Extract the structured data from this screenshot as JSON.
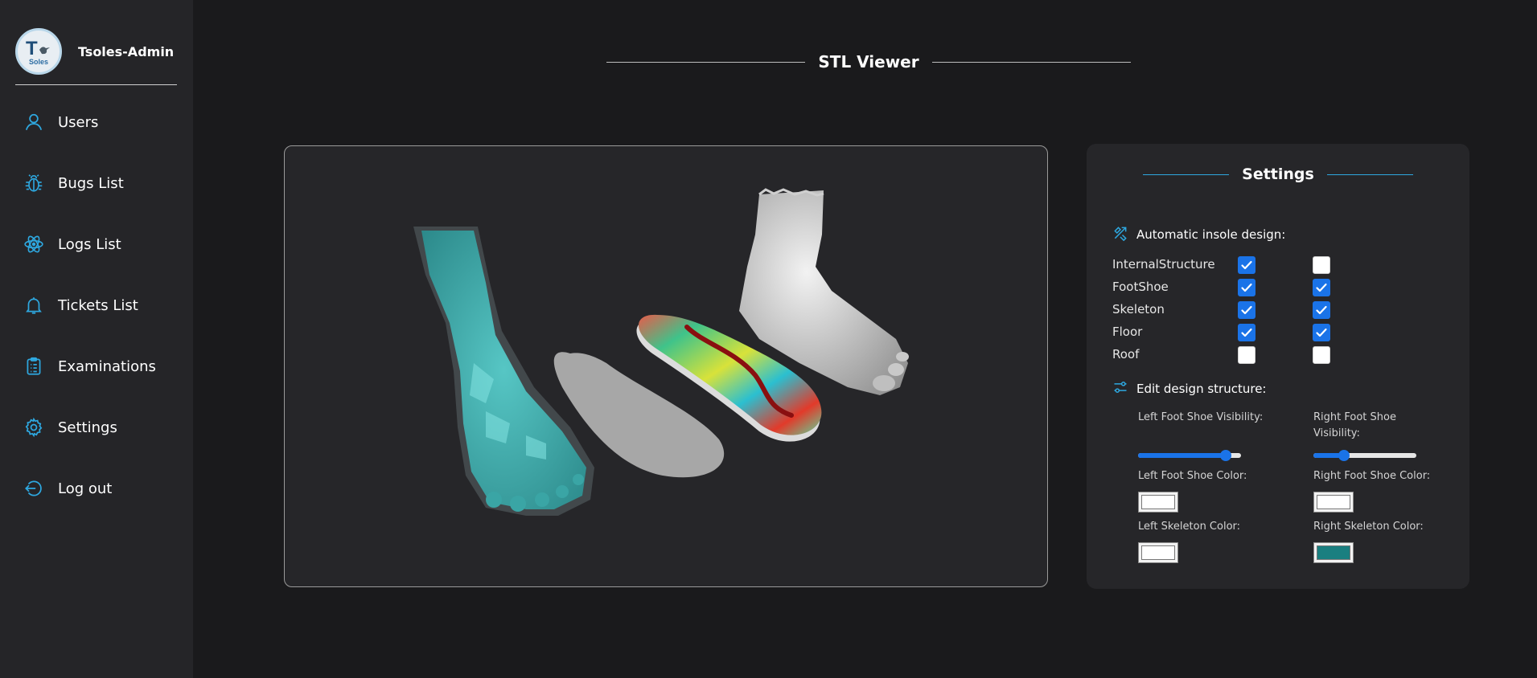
{
  "app": {
    "name": "Tsoles-Admin",
    "logo_text": "T",
    "logo_subtext": "Soles"
  },
  "sidebar": {
    "items": [
      {
        "label": "Users",
        "icon": "user-icon"
      },
      {
        "label": "Bugs List",
        "icon": "bug-icon"
      },
      {
        "label": "Logs List",
        "icon": "atom-icon"
      },
      {
        "label": "Tickets List",
        "icon": "bell-icon"
      },
      {
        "label": "Examinations",
        "icon": "clipboard-icon"
      },
      {
        "label": "Settings",
        "icon": "gear-icon"
      },
      {
        "label": "Log out",
        "icon": "logout-icon"
      }
    ]
  },
  "page": {
    "title": "STL Viewer"
  },
  "settings": {
    "title": "Settings",
    "auto_design_label": "Automatic insole design:",
    "rows": [
      {
        "label": "InternalStructure",
        "left": true,
        "right": false
      },
      {
        "label": "FootShoe",
        "left": true,
        "right": true
      },
      {
        "label": "Skeleton",
        "left": true,
        "right": true
      },
      {
        "label": "Floor",
        "left": true,
        "right": true
      },
      {
        "label": "Roof",
        "left": false,
        "right": false
      }
    ],
    "edit_label": "Edit design structure:",
    "left_visibility_label": "Left Foot Shoe Visibility:",
    "right_visibility_label": "Right Foot Shoe Visibility:",
    "left_visibility_value": 0.85,
    "right_visibility_value": 0.3,
    "left_shoe_color_label": "Left Foot Shoe Color:",
    "right_shoe_color_label": "Right Foot Shoe Color:",
    "left_skeleton_color_label": "Left Skeleton Color:",
    "right_skeleton_color_label": "Right Skeleton Color:",
    "left_shoe_color": "#ffffff",
    "right_shoe_color": "#ffffff",
    "left_skeleton_color": "#ffffff",
    "right_skeleton_color": "#1a7f80"
  },
  "colors": {
    "accent": "#2ea8e0",
    "checkbox": "#1a73e8",
    "background": "#1a1a1c",
    "panel": "#262629"
  }
}
